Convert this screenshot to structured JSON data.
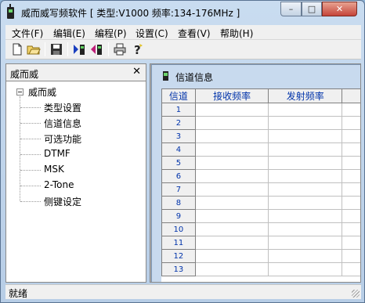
{
  "window": {
    "title": "威而威写频软件 [ 类型:V1000  频率:134-176MHz ]",
    "controls": {
      "minimize": "–",
      "maximize": "□",
      "close": "✕"
    }
  },
  "menu": [
    "文件(F)",
    "编辑(E)",
    "编程(P)",
    "设置(C)",
    "查看(V)",
    "帮助(H)"
  ],
  "toolbar": {
    "icons": [
      "new-file-icon",
      "open-folder-icon",
      "save-icon",
      "write-to-radio-icon",
      "read-from-radio-icon",
      "print-icon",
      "help-icon"
    ]
  },
  "left_panel": {
    "title": "威而威",
    "close": "✕",
    "tree": {
      "root": "威而威",
      "items": [
        "类型设置",
        "信道信息",
        "可选功能",
        "DTMF",
        "MSK",
        "2-Tone",
        "侧键设定"
      ]
    }
  },
  "child_window": {
    "title": "信道信息",
    "table": {
      "headers": [
        "信道",
        "接收频率",
        "发射频率"
      ],
      "rows": [
        "1",
        "2",
        "3",
        "4",
        "5",
        "6",
        "7",
        "8",
        "9",
        "10",
        "11",
        "12",
        "13"
      ]
    }
  },
  "status": {
    "text": "就绪"
  },
  "colors": {
    "accent_text": "#0033aa",
    "title_bar": "#c9dcf0"
  }
}
